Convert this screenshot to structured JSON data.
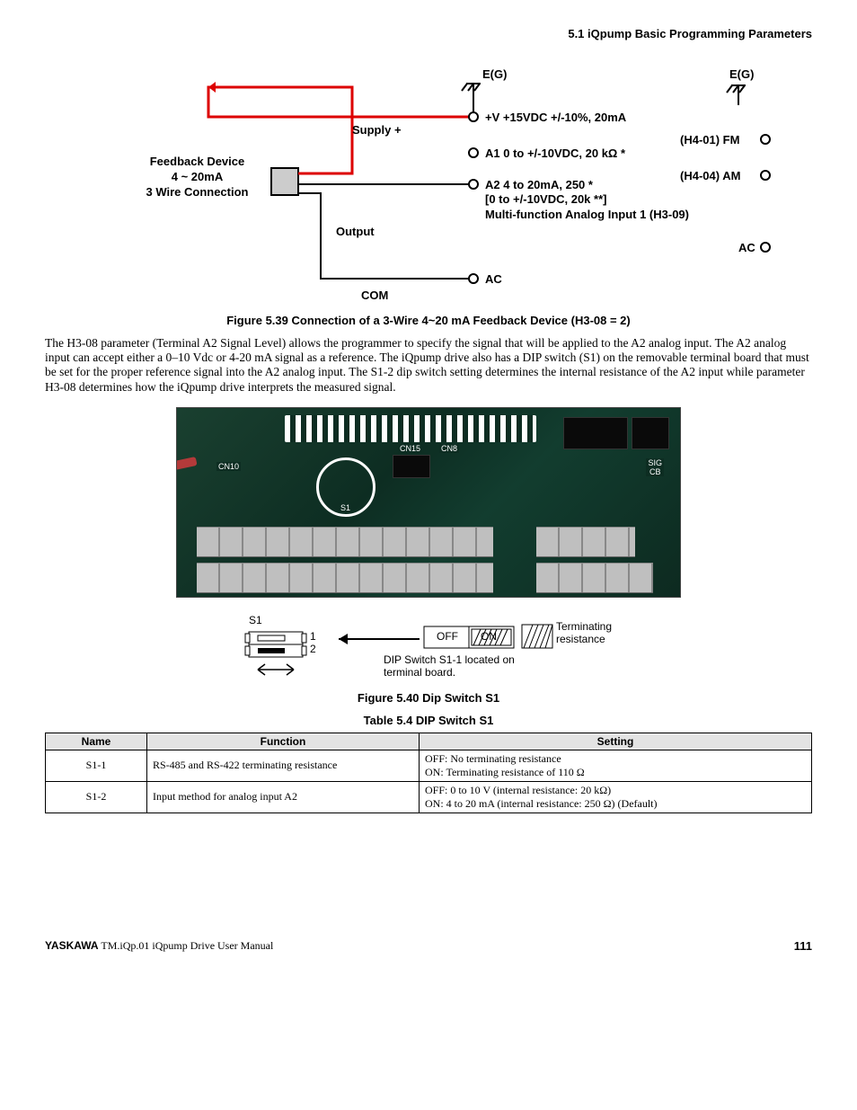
{
  "header": {
    "section": "5.1  iQpump Basic Programming Parameters"
  },
  "schematic": {
    "feedback_lines": [
      "Feedback Device",
      "4 ~ 20mA",
      "3 Wire Connection"
    ],
    "supply": "Supply +",
    "output": "Output",
    "com": "COM",
    "eg_left": "E(G)",
    "eg_right": "E(G)",
    "v_plus": "+V  +15VDC +/-10%, 20mA",
    "a1": "A1  0 to +/-10VDC, 20 kΩ *",
    "a2_l1": "A2  4 to 20mA, 250      *",
    "a2_l2": "[0 to +/-10VDC, 20k    **]",
    "a2_l3": "Multi-function Analog Input 1 (H3-09)",
    "fm": "(H4-01)  FM",
    "am": "(H4-04)  AM",
    "ac_left": "AC",
    "ac_right": "AC"
  },
  "captions": {
    "fig39": "Figure 5.39  Connection of a 3-Wire 4~20 mA Feedback Device (H3-08 = 2)",
    "fig40": "Figure 5.40  Dip Switch S1",
    "tab54": "Table 5.4   DIP Switch S1"
  },
  "paragraph": "The H3-08 parameter (Terminal A2 Signal Level) allows the programmer to specify the signal that will be applied to the A2 analog input. The A2 analog input can accept either a 0–10 Vdc or 4-20 mA signal as a reference. The iQpump drive also has a DIP switch (S1) on the removable terminal board that must be set for the proper reference signal into the A2 analog input. The S1-2 dip switch setting determines the internal resistance of the A2 input while parameter H3-08 determines how the iQpump drive interprets the measured signal.",
  "dip": {
    "s1": "S1",
    "n1": "1",
    "n2": "2",
    "off": "OFF",
    "on": "ON",
    "term": "Terminating resistance",
    "note_l1": "DIP Switch S1-1 located on",
    "note_l2": "terminal board."
  },
  "table": {
    "headers": [
      "Name",
      "Function",
      "Setting"
    ],
    "rows": [
      {
        "name": "S1-1",
        "func": "RS-485 and RS-422 terminating resistance",
        "setting_l1": "OFF: No terminating resistance",
        "setting_l2": "ON: Terminating resistance of 110 Ω"
      },
      {
        "name": "S1-2",
        "func": "Input method for analog input A2",
        "setting_l1": "OFF: 0 to 10 V (internal resistance: 20 kΩ)",
        "setting_l2": "ON: 4 to 20 mA (internal resistance: 250 Ω) (Default)"
      }
    ]
  },
  "footer": {
    "brand": "YASKAWA",
    "doc": " TM.iQp.01 iQpump Drive User Manual",
    "page": "111"
  }
}
